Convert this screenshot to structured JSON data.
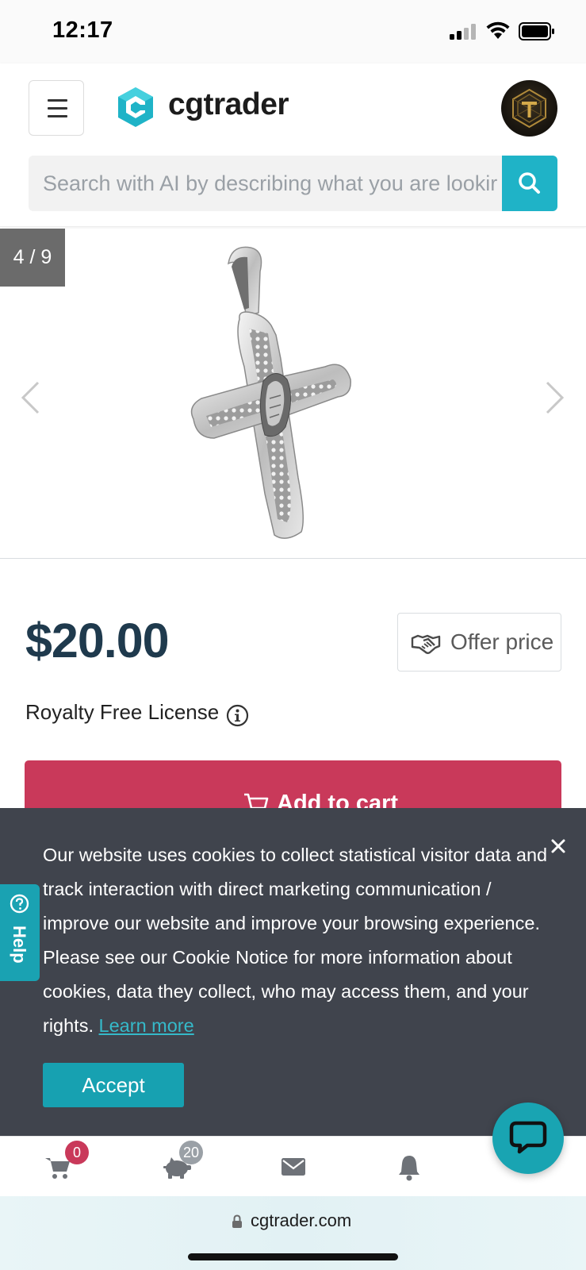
{
  "status_bar": {
    "time": "12:17"
  },
  "header": {
    "logo_text": "cgtrader",
    "search_placeholder": "Search with AI by describing what you are lookir"
  },
  "gallery": {
    "counter": "4 / 9"
  },
  "product": {
    "price": "$20.00",
    "offer_price_label": "Offer price",
    "license_label": "Royalty Free License",
    "add_to_cart_label": "Add to cart"
  },
  "cookie_banner": {
    "text": "Our website uses cookies to collect statistical visitor data and track interaction with direct marketing communication / improve our website and improve your browsing experience. Please see our Cookie Notice for more information about cookies, data they collect, who may access them, and your rights.",
    "link_label": "Learn more",
    "accept_label": "Accept"
  },
  "help_tab": {
    "label": "Help"
  },
  "bottom_nav": {
    "cart_count": "0",
    "savings_count": "20"
  },
  "url_bar": {
    "domain": "cgtrader.com"
  },
  "colors": {
    "accent": "#1fb3c7",
    "add_to_cart": "#c9395a",
    "price": "#1f3a4d",
    "cookie_bg": "#40444d",
    "cart_badge": "#c9395a",
    "savings_badge": "#9aa0a6"
  }
}
